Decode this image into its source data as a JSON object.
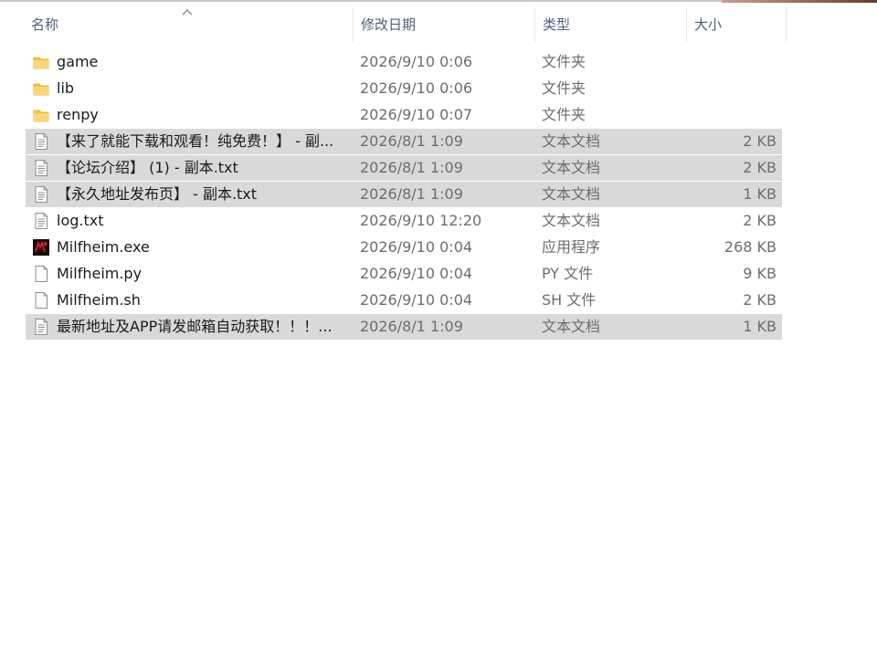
{
  "columns": {
    "name": "名称",
    "date": "修改日期",
    "type": "类型",
    "size": "大小"
  },
  "colors": {
    "selected_row": "#d9d9d9",
    "folder": "#f2c14e",
    "header_text": "#4c607a",
    "secondary_text": "#6d6d6d"
  },
  "files": [
    {
      "name": "game",
      "date": "2026/9/10 0:06",
      "type": "文件夹",
      "size": "",
      "icon": "folder-icon",
      "selected": false
    },
    {
      "name": "lib",
      "date": "2026/9/10 0:06",
      "type": "文件夹",
      "size": "",
      "icon": "folder-icon",
      "selected": false
    },
    {
      "name": "renpy",
      "date": "2026/9/10 0:07",
      "type": "文件夹",
      "size": "",
      "icon": "folder-icon",
      "selected": false
    },
    {
      "name": "【来了就能下载和观看！纯免费！】 - 副...",
      "date": "2026/8/1 1:09",
      "type": "文本文档",
      "size": "2 KB",
      "icon": "text-file-icon",
      "selected": true
    },
    {
      "name": "【论坛介绍】 (1) - 副本.txt",
      "date": "2026/8/1 1:09",
      "type": "文本文档",
      "size": "2 KB",
      "icon": "text-file-icon",
      "selected": true
    },
    {
      "name": "【永久地址发布页】  - 副本.txt",
      "date": "2026/8/1 1:09",
      "type": "文本文档",
      "size": "1 KB",
      "icon": "text-file-icon",
      "selected": true
    },
    {
      "name": "log.txt",
      "date": "2026/9/10 12:20",
      "type": "文本文档",
      "size": "2 KB",
      "icon": "text-file-icon",
      "selected": false
    },
    {
      "name": "Milfheim.exe",
      "date": "2026/9/10 0:04",
      "type": "应用程序",
      "size": "268 KB",
      "icon": "app-icon",
      "selected": false
    },
    {
      "name": "Milfheim.py",
      "date": "2026/9/10 0:04",
      "type": "PY 文件",
      "size": "9 KB",
      "icon": "blank-file-icon",
      "selected": false
    },
    {
      "name": "Milfheim.sh",
      "date": "2026/9/10 0:04",
      "type": "SH 文件",
      "size": "2 KB",
      "icon": "blank-file-icon",
      "selected": false
    },
    {
      "name": "最新地址及APP请发邮箱自动获取！！！...",
      "date": "2026/8/1 1:09",
      "type": "文本文档",
      "size": "1 KB",
      "icon": "text-file-icon",
      "selected": true
    }
  ]
}
